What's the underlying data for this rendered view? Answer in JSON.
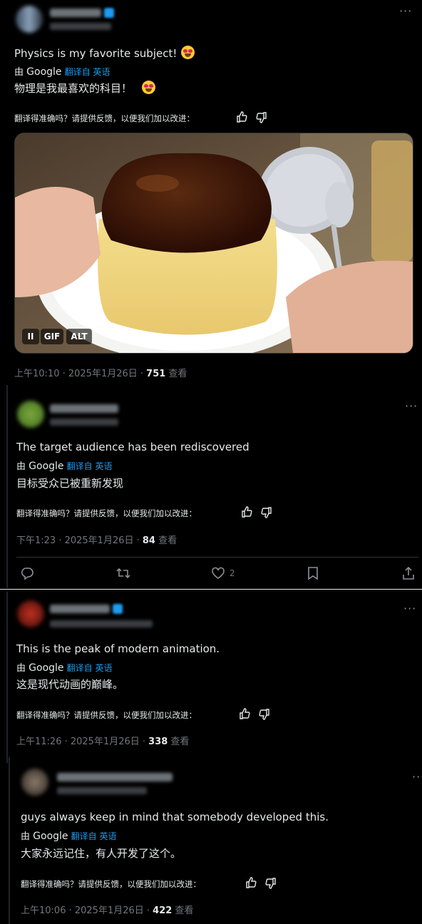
{
  "tweet1": {
    "text": "Physics is my favorite subject!",
    "translate": {
      "by": "由",
      "google": "Google",
      "link": "翻译自 英语"
    },
    "zh": "物理是我最喜欢的科目！",
    "feedback": "翻译得准确吗？请提供反馈，以便我们加以改进：",
    "media": {
      "pause": "II",
      "gif": "GIF",
      "alt": "ALT"
    },
    "time": "上午10:10 · 2025年1月26日 · ",
    "views": "751",
    "views_label": " 查看"
  },
  "tweet2": {
    "text": "The target audience has been rediscovered",
    "translate": {
      "by": "由",
      "google": "Google",
      "link": "翻译自 英语"
    },
    "zh": "目标受众已被重新发现",
    "feedback": "翻译得准确吗？请提供反馈，以便我们加以改进：",
    "time": "下午1:23 · 2025年1月26日 · ",
    "views": "84",
    "views_label": " 查看",
    "likes": "2"
  },
  "tweet3": {
    "text": "This is the peak of modern animation.",
    "translate": {
      "by": "由",
      "google": "Google",
      "link": "翻译自 英语"
    },
    "zh": "这是现代动画的巅峰。",
    "feedback": "翻译得准确吗？请提供反馈，以便我们加以改进：",
    "time": "上午11:26 · 2025年1月26日 · ",
    "views": "338",
    "views_label": " 查看"
  },
  "tweet4": {
    "text": "guys always keep in mind that somebody developed this.",
    "translate": {
      "by": "由",
      "google": "Google",
      "link": "翻译自 英语"
    },
    "zh": "大家永远记住，有人开发了这个。",
    "feedback": "翻译得准确吗？请提供反馈，以便我们加以改进：",
    "time": "上午10:06 · 2025年1月26日 · ",
    "views": "422",
    "views_label": " 查看"
  },
  "more_label": "···",
  "icons": [
    "more-icon",
    "thumbs-up-icon",
    "thumbs-down-icon",
    "reply-icon",
    "retweet-icon",
    "like-icon",
    "bookmark-icon",
    "share-icon"
  ]
}
